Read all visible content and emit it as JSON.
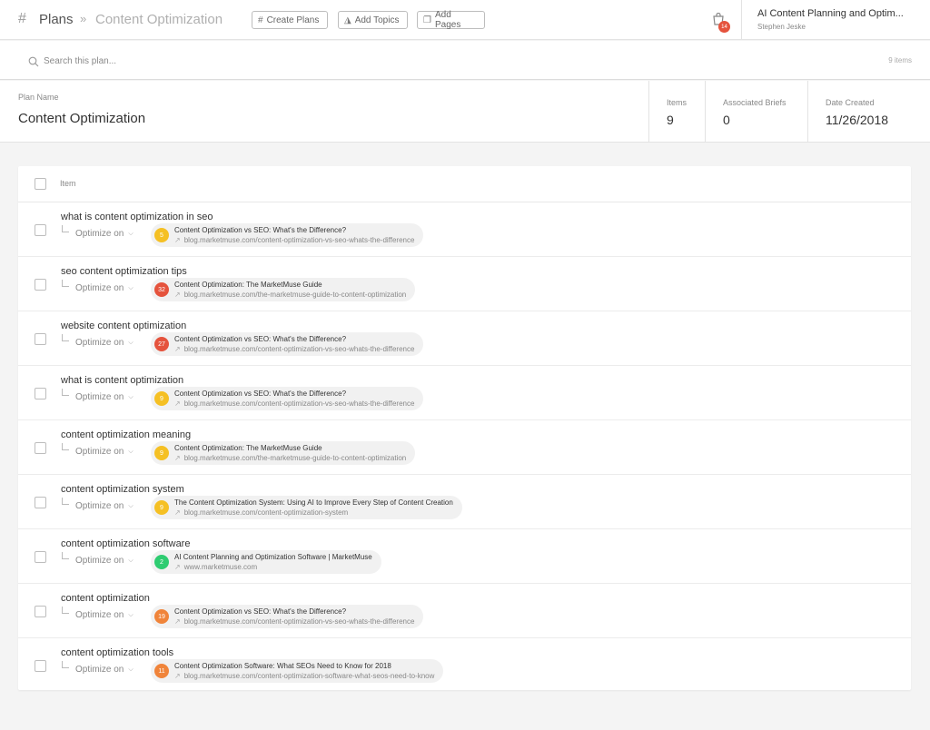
{
  "header": {
    "section": "Plans",
    "separator": "»",
    "current": "Content Optimization",
    "buttons": {
      "create_plans": "Create Plans",
      "add_topics": "Add Topics",
      "add_pages": "Add Pages"
    },
    "notification_count": "14",
    "account_title": "AI Content Planning and Optim...",
    "account_user": "Stephen Jeske"
  },
  "search": {
    "placeholder": "Search this plan...",
    "count": "9 items"
  },
  "summary": {
    "plan_name_label": "Plan Name",
    "plan_name": "Content Optimization",
    "items_label": "Items",
    "items_value": "9",
    "briefs_label": "Associated Briefs",
    "briefs_value": "0",
    "date_label": "Date Created",
    "date_value": "11/26/2018"
  },
  "table": {
    "header_label": "Item",
    "optimize_label": "Optimize on",
    "rows": [
      {
        "keyword": "what is content optimization in seo",
        "score": "5",
        "score_color": "#f5c024",
        "page_title": "Content Optimization vs SEO: What's the Difference?",
        "page_url": "blog.marketmuse.com/content-optimization-vs-seo-whats-the-difference"
      },
      {
        "keyword": "seo content optimization tips",
        "score": "32",
        "score_color": "#e5533d",
        "page_title": "Content Optimization: The MarketMuse Guide",
        "page_url": "blog.marketmuse.com/the-marketmuse-guide-to-content-optimization"
      },
      {
        "keyword": "website content optimization",
        "score": "27",
        "score_color": "#e5533d",
        "page_title": "Content Optimization vs SEO: What's the Difference?",
        "page_url": "blog.marketmuse.com/content-optimization-vs-seo-whats-the-difference"
      },
      {
        "keyword": "what is content optimization",
        "score": "9",
        "score_color": "#f5c024",
        "page_title": "Content Optimization vs SEO: What's the Difference?",
        "page_url": "blog.marketmuse.com/content-optimization-vs-seo-whats-the-difference"
      },
      {
        "keyword": "content optimization meaning",
        "score": "9",
        "score_color": "#f5c024",
        "page_title": "Content Optimization: The MarketMuse Guide",
        "page_url": "blog.marketmuse.com/the-marketmuse-guide-to-content-optimization"
      },
      {
        "keyword": "content optimization system",
        "score": "9",
        "score_color": "#f5c024",
        "page_title": "The Content Optimization System: Using AI to Improve Every Step of Content Creation",
        "page_url": "blog.marketmuse.com/content-optimization-system"
      },
      {
        "keyword": "content optimization software",
        "score": "2",
        "score_color": "#2ecc71",
        "page_title": "AI Content Planning and Optimization Software | MarketMuse",
        "page_url": "www.marketmuse.com"
      },
      {
        "keyword": "content optimization",
        "score": "19",
        "score_color": "#f0843a",
        "page_title": "Content Optimization vs SEO: What's the Difference?",
        "page_url": "blog.marketmuse.com/content-optimization-vs-seo-whats-the-difference"
      },
      {
        "keyword": "content optimization tools",
        "score": "11",
        "score_color": "#f0843a",
        "page_title": "Content Optimization Software: What SEOs Need to Know for 2018",
        "page_url": "blog.marketmuse.com/content-optimization-software-what-seos-need-to-know"
      }
    ]
  }
}
